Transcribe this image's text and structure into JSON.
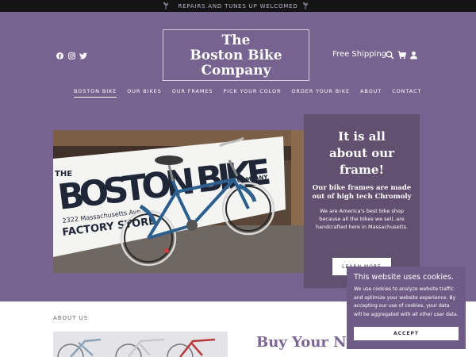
{
  "announcement": {
    "text": "REPAIRS AND TUNES UP WELCOMED"
  },
  "brand": {
    "line1": "The",
    "line2": "Boston Bike",
    "line3": "Company"
  },
  "header": {
    "shipping_label": "Free Shipping",
    "icons": [
      "facebook-icon",
      "instagram-icon",
      "twitter-icon",
      "search-icon",
      "cart-icon",
      "user-icon"
    ]
  },
  "nav": {
    "items": [
      {
        "label": "BOSTON BIKE"
      },
      {
        "label": "OUR BIKES"
      },
      {
        "label": "OUR FRAMES"
      },
      {
        "label": "PICK YOUR COLOR"
      },
      {
        "label": "ORDER YOUR BIKE"
      },
      {
        "label": "ABOUT"
      },
      {
        "label": "CONTACT"
      }
    ]
  },
  "hero": {
    "sign_main": "BOSTON BIKE",
    "sign_the": "THE",
    "sign_company": "COMPANY",
    "sign_address": "2322 Massachusetts Ave",
    "sign_factory": "FACTORY STORE",
    "headline_1": "It is all",
    "headline_2": "about our",
    "headline_3": "frame!",
    "subheadline": "Our bike frames are made out of high tech Chromoly",
    "body": "We are America's best bike shop because all the bikes we sell, are handcrafted here in Massachusetts.",
    "cta_label": "LEARN MORE"
  },
  "about": {
    "section_label": "ABOUT US",
    "title": "Buy Your New"
  },
  "cookie": {
    "title": "This website uses cookies.",
    "body": "We use cookies to analyze website traffic and optimize your website experience. By accepting our use of cookies, your data will be aggregated with all other user data.",
    "accept_label": "ACCEPT"
  },
  "colors": {
    "hero": "#76638f",
    "panel": "#61506f",
    "cookie": "#6e5c86",
    "topbar": "#141414"
  }
}
